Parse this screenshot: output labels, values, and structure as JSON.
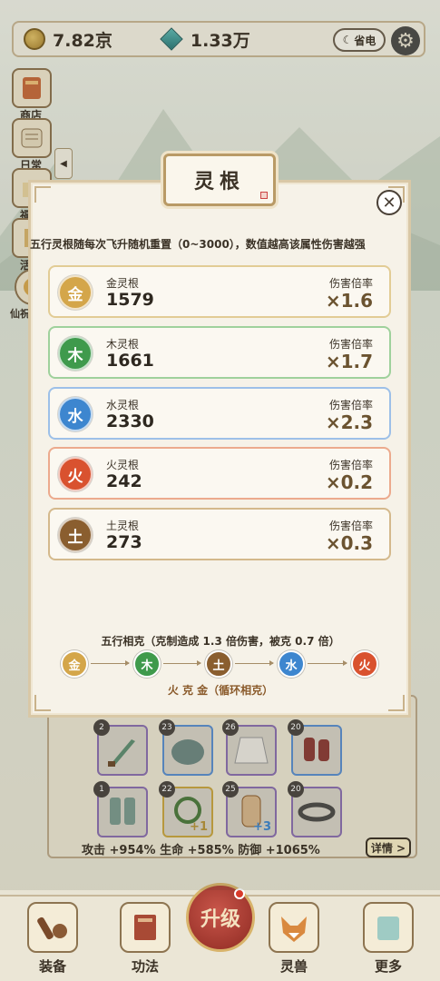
{
  "currency": {
    "coins": "7.82京",
    "gems": "1.33万",
    "save_label": "省电"
  },
  "side_menu": [
    {
      "label": "商店",
      "icon": "shop-icon"
    },
    {
      "label": "日常",
      "icon": "scroll-icon"
    },
    {
      "label": "福",
      "icon": "gift-icon"
    },
    {
      "label": "活",
      "icon": "event-icon"
    },
    {
      "label": "仙祝",
      "icon": "immortal-icon"
    }
  ],
  "modal": {
    "title": "灵根",
    "description": "五行灵根随每次飞升随机重置（0~3000），数值越高该属性伤害越强",
    "roots": [
      {
        "element": "金",
        "name": "金灵根",
        "value": "1579",
        "rate_label": "伤害倍率",
        "multiplier": "×1.6",
        "color": "#d4a64a",
        "border": "#e2cc95"
      },
      {
        "element": "木",
        "name": "木灵根",
        "value": "1661",
        "rate_label": "伤害倍率",
        "multiplier": "×1.7",
        "color": "#3f9a4c",
        "border": "#9fd19c"
      },
      {
        "element": "水",
        "name": "水灵根",
        "value": "2330",
        "rate_label": "伤害倍率",
        "multiplier": "×2.3",
        "color": "#3d86cf",
        "border": "#9dc0e8"
      },
      {
        "element": "火",
        "name": "火灵根",
        "value": "242",
        "rate_label": "伤害倍率",
        "multiplier": "×0.2",
        "color": "#d9522f",
        "border": "#ecaa8d"
      },
      {
        "element": "土",
        "name": "土灵根",
        "value": "273",
        "rate_label": "伤害倍率",
        "multiplier": "×0.3",
        "color": "#8a5e2f",
        "border": "#d4b98c"
      }
    ],
    "cycle_title": "五行相克（克制造成 1.3 倍伤害，被克 0.7 倍）",
    "cycle": [
      {
        "element": "金",
        "color": "#d4a64a"
      },
      {
        "element": "木",
        "color": "#3f9a4c"
      },
      {
        "element": "土",
        "color": "#8a5e2f"
      },
      {
        "element": "水",
        "color": "#3d86cf"
      },
      {
        "element": "火",
        "color": "#d9522f"
      }
    ],
    "cycle_note": "火 克 金（循环相克）"
  },
  "equipment": {
    "slots": [
      {
        "level": "2",
        "icon": "dagger-icon",
        "frame": "purple"
      },
      {
        "level": "23",
        "icon": "helmet-icon",
        "frame": "blue"
      },
      {
        "level": "26",
        "icon": "robe-icon",
        "frame": "purple"
      },
      {
        "level": "20",
        "icon": "gauntlet-icon",
        "frame": "blue"
      },
      {
        "level": "1",
        "icon": "boots-icon",
        "frame": "purple"
      },
      {
        "level": "22",
        "icon": "vine-ring-icon",
        "frame": "gold",
        "plus": "+1"
      },
      {
        "level": "25",
        "icon": "talisman-icon",
        "frame": "purple",
        "plus": "+3"
      },
      {
        "level": "20",
        "icon": "belt-icon",
        "frame": "purple"
      }
    ],
    "stats": "攻击 +954%  生命 +585%  防御 +1065%",
    "detail_label": "详情 >"
  },
  "nav": {
    "items": [
      {
        "label": "装备",
        "icon": "equipment-icon"
      },
      {
        "label": "功法",
        "icon": "book-icon"
      },
      {
        "label": "灵兽",
        "icon": "fox-icon"
      },
      {
        "label": "更多",
        "icon": "more-icon"
      }
    ],
    "upgrade_label": "升级"
  }
}
